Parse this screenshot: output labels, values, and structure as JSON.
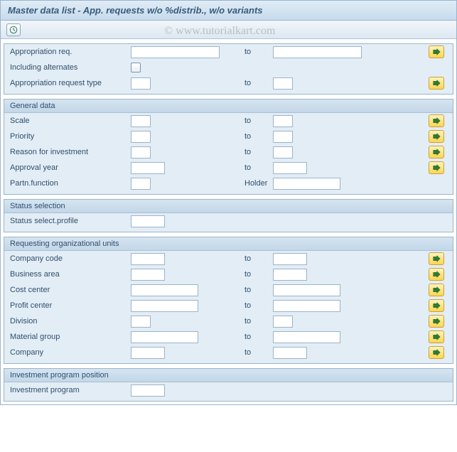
{
  "title": "Master data list - App. requests w/o %distrib., w/o variants",
  "watermark": "© www.tutorialkart.com",
  "labels": {
    "to": "to",
    "approp_req": "Appropriation req.",
    "including_alternates": "Including alternates",
    "approp_req_type": "Appropriation request type",
    "holder": "Holder"
  },
  "sections": {
    "general": {
      "title": "General data",
      "scale": "Scale",
      "priority": "Priority",
      "reason": "Reason for investment",
      "approval_year": "Approval year",
      "partn_function": "Partn.function"
    },
    "status": {
      "title": "Status selection",
      "profile": "Status select.profile"
    },
    "orgunits": {
      "title": "Requesting organizational units",
      "company_code": "Company code",
      "business_area": "Business area",
      "cost_center": "Cost center",
      "profit_center": "Profit center",
      "division": "Division",
      "material_group": "Material group",
      "company": "Company"
    },
    "invprog": {
      "title": "Investment program position",
      "investment_program": "Investment program"
    }
  }
}
